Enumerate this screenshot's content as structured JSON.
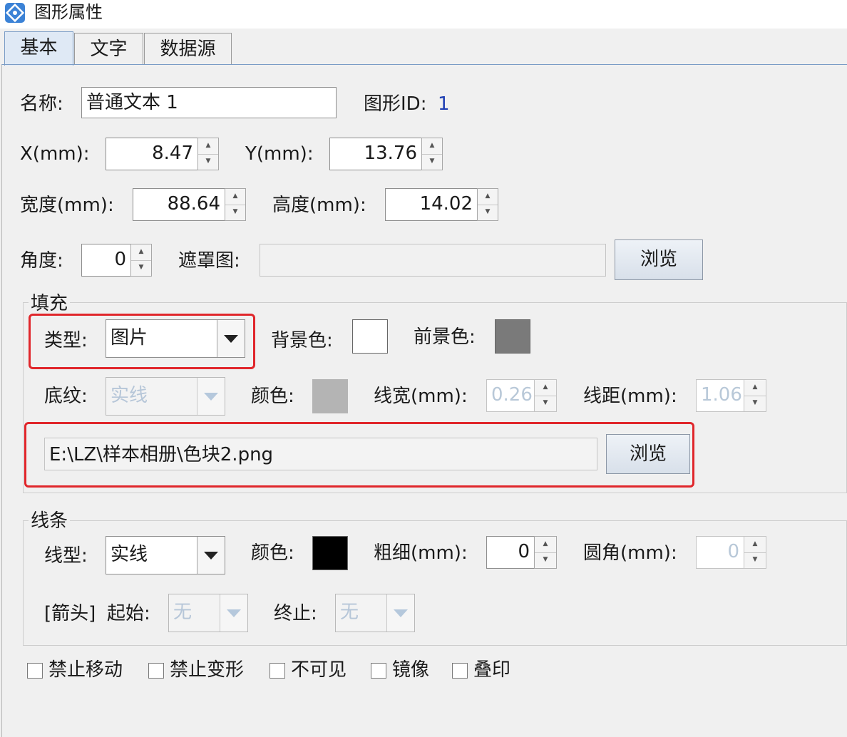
{
  "window": {
    "title": "图形属性"
  },
  "tabs": [
    {
      "label": "基本",
      "active": true
    },
    {
      "label": "文字",
      "active": false
    },
    {
      "label": "数据源",
      "active": false
    }
  ],
  "basic": {
    "name_label": "名称:",
    "name_value": "普通文本 1",
    "shape_id_label": "图形ID:",
    "shape_id_value": "1",
    "x_label": "X(mm):",
    "x_value": "8.47",
    "y_label": "Y(mm):",
    "y_value": "13.76",
    "width_label": "宽度(mm):",
    "width_value": "88.64",
    "height_label": "高度(mm):",
    "height_value": "14.02",
    "angle_label": "角度:",
    "angle_value": "0",
    "mask_label": "遮罩图:",
    "mask_value": "",
    "browse_label": "浏览"
  },
  "fill": {
    "legend": "填充",
    "type_label": "类型:",
    "type_value": "图片",
    "bg_color_label": "背景色:",
    "bg_color": "#ffffff",
    "fg_color_label": "前景色:",
    "fg_color": "#7a7a7a",
    "pattern_label": "底纹:",
    "pattern_value": "实线",
    "color_label": "颜色:",
    "color": "#b4b4b4",
    "line_width_label": "线宽(mm):",
    "line_width_value": "0.26",
    "line_spacing_label": "线距(mm):",
    "line_spacing_value": "1.06",
    "image_path": "E:\\LZ\\样本相册\\色块2.png",
    "browse_label": "浏览"
  },
  "line": {
    "legend": "线条",
    "type_label": "线型:",
    "type_value": "实线",
    "color_label": "颜色:",
    "color": "#000000",
    "thickness_label": "粗细(mm):",
    "thickness_value": "0",
    "corner_label": "圆角(mm):",
    "corner_value": "0",
    "arrow_label": "[箭头]",
    "start_label": "起始:",
    "start_value": "无",
    "end_label": "终止:",
    "end_value": "无"
  },
  "options": [
    {
      "label": "禁止移动",
      "checked": false
    },
    {
      "label": "禁止变形",
      "checked": false
    },
    {
      "label": "不可见",
      "checked": false
    },
    {
      "label": "镜像",
      "checked": false
    },
    {
      "label": "叠印",
      "checked": false
    }
  ]
}
